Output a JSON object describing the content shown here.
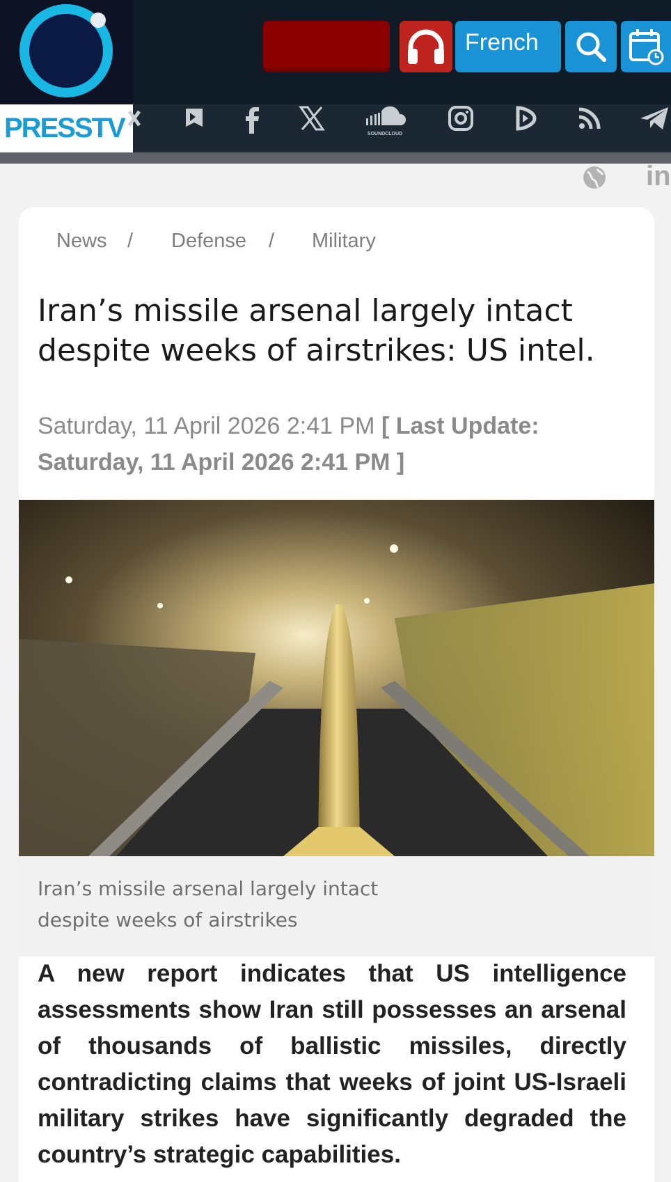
{
  "header": {
    "logo_text": "PRESSTV",
    "language_button": "French",
    "icons": [
      "live-button",
      "headphones-icon",
      "search-icon",
      "calendar-icon"
    ]
  },
  "social": [
    "x-icon",
    "bookmark-icon",
    "facebook-icon",
    "x-icon",
    "soundcloud-icon",
    "instagram-icon",
    "video-icon",
    "rss-icon",
    "telegram-icon",
    "globe-icon",
    "linkedin-icon"
  ],
  "social_labels": {
    "soundcloud": "SOUNDCLOUD",
    "linkedin": "in"
  },
  "breadcrumb": [
    {
      "label": "News",
      "sep": "/"
    },
    {
      "label": "Defense",
      "sep": "/"
    },
    {
      "label": "Military"
    }
  ],
  "article": {
    "title": "Iran’s missile arsenal largely intact despite weeks of airstrikes: US intel.",
    "date": "Saturday, 11 April 2026 2:41 PM",
    "last_update": "[ Last Update: Saturday, 11 April 2026 2:41 PM ]",
    "image_caption": "Iran’s missile arsenal largely intact despite weeks of airstrikes",
    "lead": "A new report indicates that US intelligence assessments show Iran still possesses an arsenal of thousands of ballistic missiles, directly contradicting claims that weeks of joint US-Israeli military strikes have significantly degraded the country’s strategic capabilities."
  },
  "colors": {
    "header_bg": "#0f1b26",
    "brand_blue": "#1a93d6",
    "live_red": "#8a0000",
    "audio_red": "#c0241f"
  }
}
